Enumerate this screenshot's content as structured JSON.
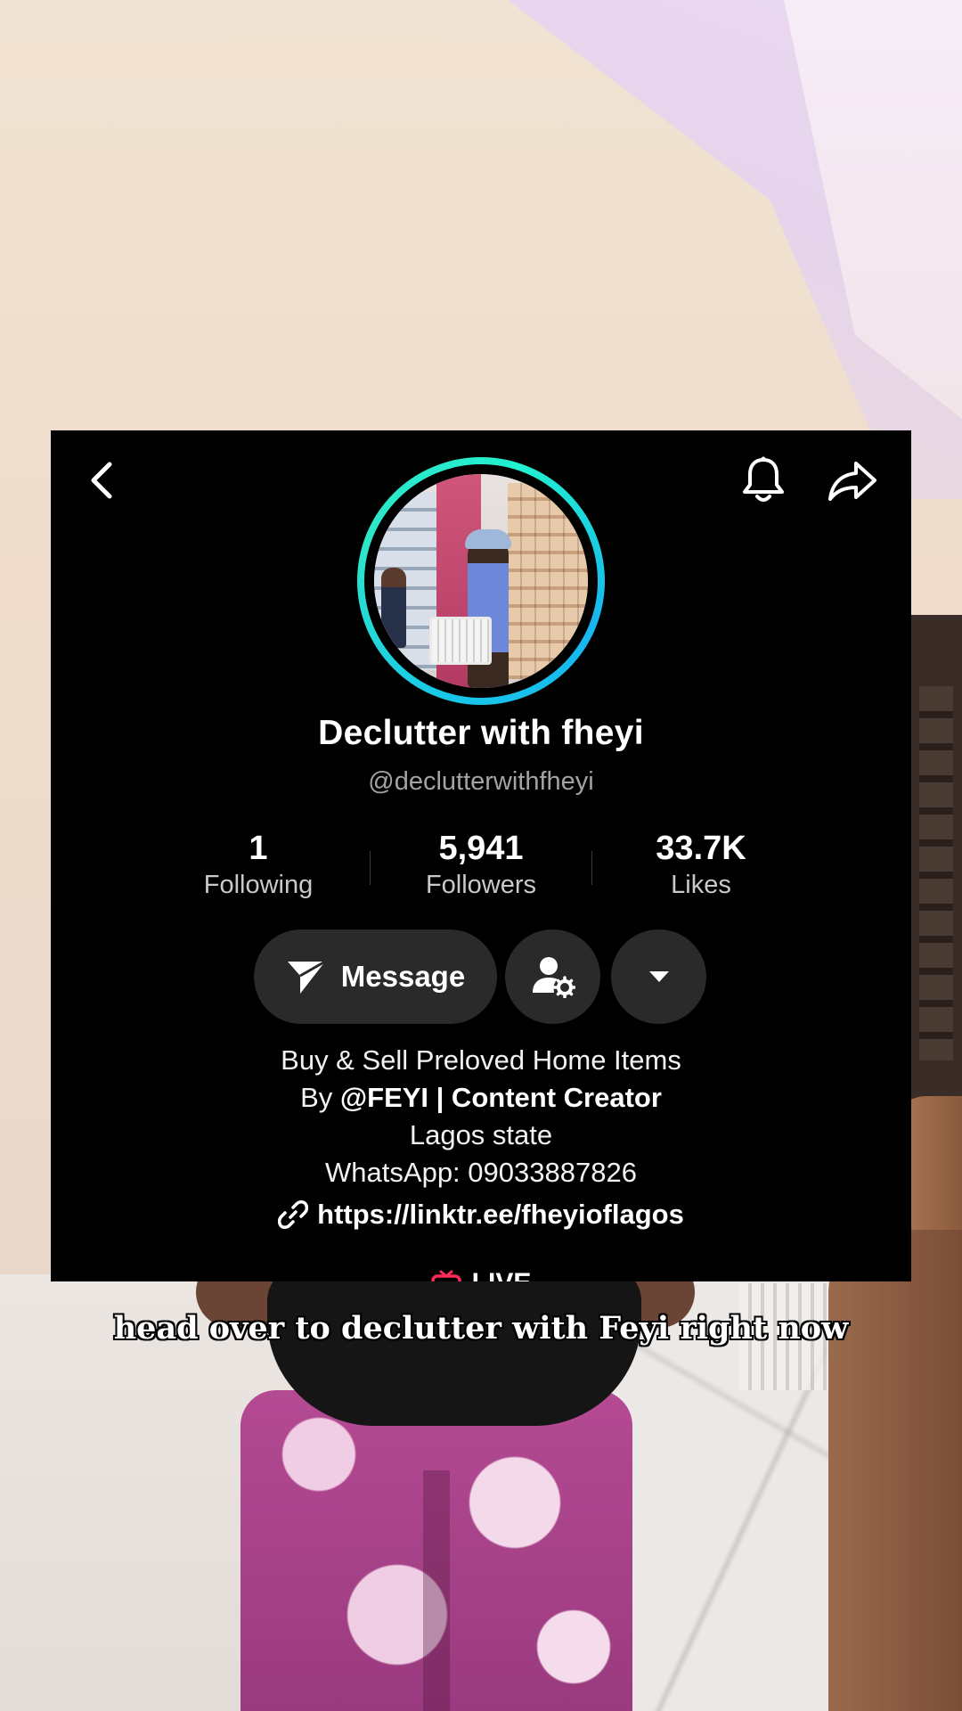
{
  "profile": {
    "display_name": "Declutter with fheyi",
    "handle": "@declutterwithfheyi",
    "stats": [
      {
        "value": "1",
        "label": "Following"
      },
      {
        "value": "5,941",
        "label": "Followers"
      },
      {
        "value": "33.7K",
        "label": "Likes"
      }
    ],
    "message_label": "Message",
    "bio": {
      "line1": "Buy & Sell Preloved Home Items",
      "line2_prefix": "By ",
      "line2_bold": "@FEYI | Content Creator",
      "line3": "Lagos state",
      "line4": "WhatsApp: 09033887826"
    },
    "link": "https://linktr.ee/fheyioflagos",
    "live_label": "LIVE"
  },
  "icons": {
    "back": "chevron-left-icon",
    "bell": "bell-icon",
    "share": "share-arrow-icon",
    "message": "paper-plane-icon",
    "friends": "person-gear-icon",
    "more": "caret-down-icon",
    "link": "link-icon",
    "live": "tv-icon"
  },
  "colors": {
    "card_bg": "#000000",
    "avatar_ring_a": "#18c8e8",
    "avatar_ring_b": "#21f0d0",
    "button_bg": "#2a2a2a",
    "live_red": "#fe2c55"
  },
  "caption": "head over to declutter with Feyi right now"
}
